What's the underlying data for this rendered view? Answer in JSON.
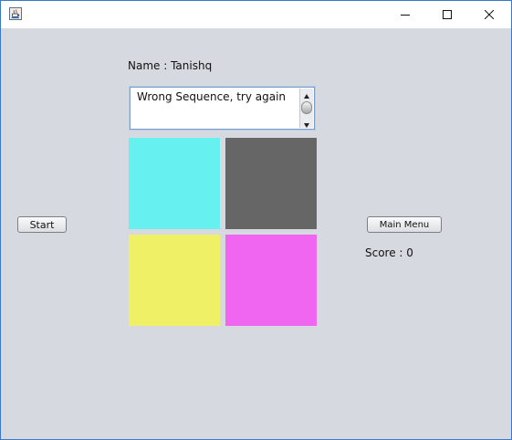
{
  "window": {
    "title": "",
    "icon": "java-app-icon",
    "controls": {
      "minimize": "minimize-icon",
      "maximize": "maximize-icon",
      "close": "close-icon"
    }
  },
  "game": {
    "name_label": "Name : Tanishq",
    "message": "Wrong Sequence, try again",
    "tiles": [
      {
        "color": "#66f0f0"
      },
      {
        "color": "#666666"
      },
      {
        "color": "#f0f066"
      },
      {
        "color": "#f066f0"
      }
    ],
    "start_label": "Start",
    "menu_label": "Main Menu",
    "score_label": "Score : 0"
  }
}
